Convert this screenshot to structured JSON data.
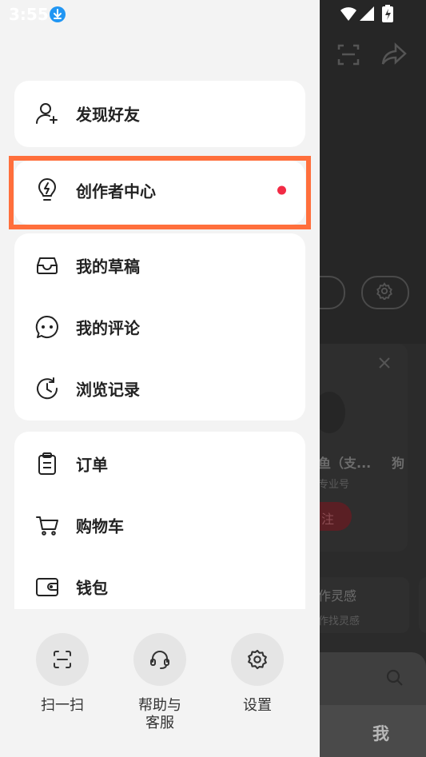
{
  "status_bar": {
    "time": "3:55"
  },
  "drawer": {
    "top_panel": {
      "find_friends": "发现好友"
    },
    "creator": {
      "label": "创作者中心",
      "has_dot": true
    },
    "group2": [
      {
        "label": "我的草稿",
        "icon": "inbox-icon"
      },
      {
        "label": "我的评论",
        "icon": "comment-icon"
      },
      {
        "label": "浏览记录",
        "icon": "history-icon"
      }
    ],
    "group3": [
      {
        "label": "订单",
        "icon": "clipboard-icon"
      },
      {
        "label": "购物车",
        "icon": "cart-icon"
      },
      {
        "label": "钱包",
        "icon": "wallet-icon"
      }
    ],
    "quick_actions": [
      {
        "label": "扫一扫",
        "icon": "scan-icon"
      },
      {
        "label": "帮助与\n客服",
        "icon": "headset-icon"
      },
      {
        "label": "设置",
        "icon": "gear-icon"
      }
    ]
  },
  "background": {
    "card_title": "鱼（支...",
    "card_title2": "狗",
    "card_sub": "专业号",
    "follow_btn": "注",
    "inspire_title": "作灵感",
    "inspire_sub": "作找灵感",
    "tab_me": "我"
  },
  "colors": {
    "highlight": "#ff6f3c",
    "dot": "#f22b45",
    "accent_blue": "#2196f3"
  }
}
